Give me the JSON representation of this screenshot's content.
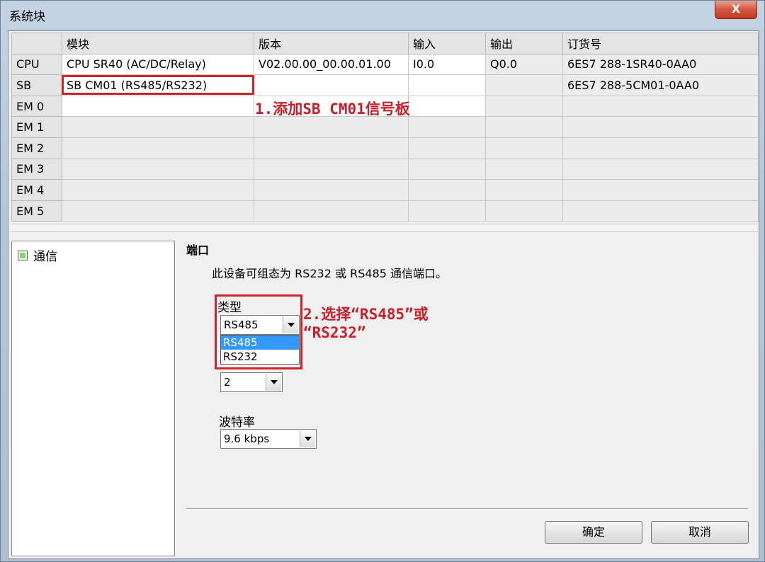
{
  "window": {
    "title": "系统块",
    "close_label": "X"
  },
  "grid": {
    "columns": [
      "模块",
      "版本",
      "输入",
      "输出",
      "订货号"
    ],
    "rows": [
      {
        "slot": "CPU",
        "module": "CPU SR40 (AC/DC/Relay)",
        "version": "V02.00.00_00.00.01.00",
        "input": "I0.0",
        "output": "Q0.0",
        "order": "6ES7 288-1SR40-0AA0"
      },
      {
        "slot": "SB",
        "module": "SB CM01 (RS485/RS232)",
        "version": "",
        "input": "",
        "output": "",
        "order": "6ES7 288-5CM01-0AA0"
      },
      {
        "slot": "EM 0",
        "module": "",
        "version": "",
        "input": "",
        "output": "",
        "order": ""
      },
      {
        "slot": "EM 1",
        "module": "",
        "version": "",
        "input": "",
        "output": "",
        "order": ""
      },
      {
        "slot": "EM 2",
        "module": "",
        "version": "",
        "input": "",
        "output": "",
        "order": ""
      },
      {
        "slot": "EM 3",
        "module": "",
        "version": "",
        "input": "",
        "output": "",
        "order": ""
      },
      {
        "slot": "EM 4",
        "module": "",
        "version": "",
        "input": "",
        "output": "",
        "order": ""
      },
      {
        "slot": "EM 5",
        "module": "",
        "version": "",
        "input": "",
        "output": "",
        "order": ""
      }
    ]
  },
  "annotations": {
    "step1": "1.添加SB CM01信号板",
    "step2_line1": "2.选择“RS485”或",
    "step2_line2": "“RS232”"
  },
  "tree": {
    "items": [
      {
        "label": "通信",
        "icon": "green-square-icon"
      }
    ]
  },
  "port": {
    "heading": "端口",
    "description": "此设备可组态为 RS232 或 RS485 通信端口。",
    "type_label": "类型",
    "type_value": "RS485",
    "type_options": [
      "RS485",
      "RS232"
    ],
    "address_value": "2",
    "baud_label": "波特率",
    "baud_value": "9.6 kbps"
  },
  "buttons": {
    "ok": "确定",
    "cancel": "取消"
  },
  "colors": {
    "annotation": "#d2232a",
    "selection": "#3399ff"
  }
}
